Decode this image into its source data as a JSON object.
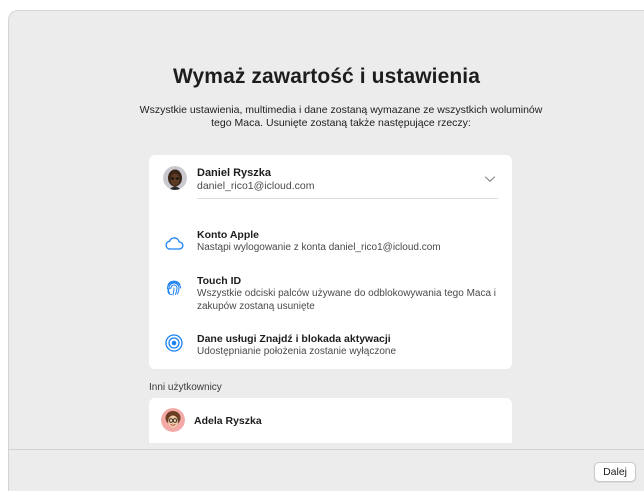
{
  "window": {
    "title": "Wymaż zawartość i ustawienia",
    "subtitle": "Wszystkie ustawienia, multimedia i dane zostaną wymazane ze wszystkich woluminów tego Maca. Usunięte zostaną także następujące rzeczy:"
  },
  "account": {
    "name": "Daniel Ryszka",
    "email": "daniel_rico1@icloud.com",
    "avatar_icon": "memoji-avatar",
    "expand_icon": "chevron-down-icon"
  },
  "items": [
    {
      "icon": "cloud-icon",
      "title": "Konto Apple",
      "description": "Nastąpi wylogowanie z konta daniel_rico1@icloud.com"
    },
    {
      "icon": "fingerprint-icon",
      "title": "Touch ID",
      "description": "Wszystkie odciski palców używane do odblokowywania tego Maca i zakupów zostaną usunięte"
    },
    {
      "icon": "findmy-icon",
      "title": "Dane usługi Znajdź i blokada aktywacji",
      "description": "Udostępnianie położenia zostanie wyłączone"
    }
  ],
  "others": {
    "label": "Inni użytkownicy",
    "users": [
      {
        "name": "Adela Ryszka",
        "avatar_icon": "memoji-avatar"
      }
    ]
  },
  "footer": {
    "next_label": "Dalej"
  },
  "colors": {
    "accent": "#1a7ff5",
    "window_bg": "#ececec",
    "card_bg": "#ffffff"
  }
}
